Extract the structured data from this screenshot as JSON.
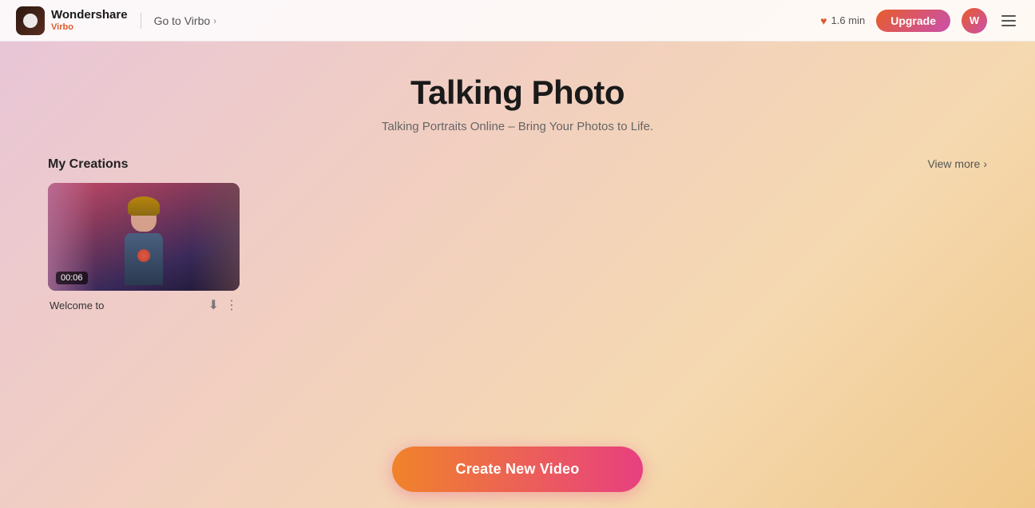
{
  "navbar": {
    "logo_brand": "Wondershare",
    "logo_product": "Virbo",
    "go_to_virbo": "Go to Virbo",
    "minutes": "1.6 min",
    "upgrade_label": "Upgrade",
    "avatar_initials": "W"
  },
  "page": {
    "title": "Talking Photo",
    "subtitle": "Talking Portraits Online – Bring Your Photos to Life.",
    "view_more": "View more"
  },
  "creations": {
    "section_title": "My Creations",
    "items": [
      {
        "name": "Welcome to",
        "duration": "00:06"
      }
    ]
  },
  "cta": {
    "button_label": "Create New Video"
  }
}
